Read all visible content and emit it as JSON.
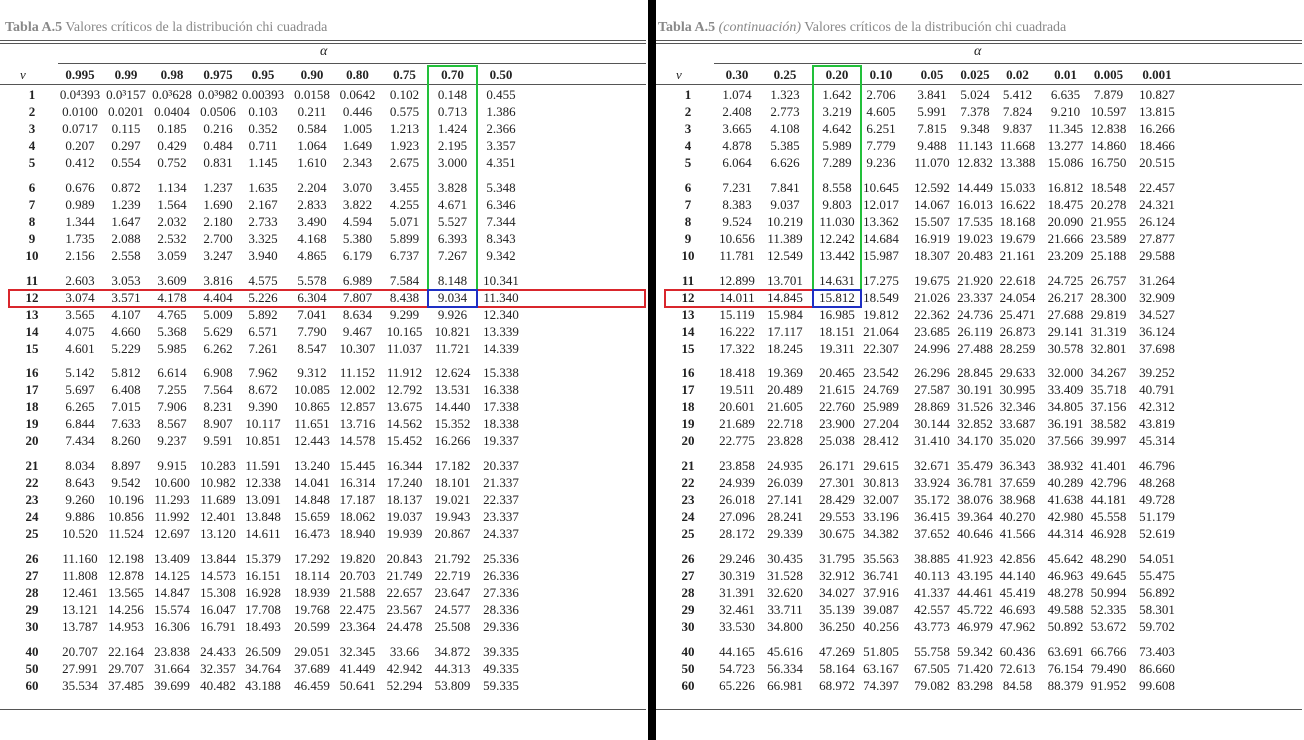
{
  "left": {
    "title_bold": "Tabla A.5",
    "title_rest": "Valores críticos de la distribución chi cuadrada",
    "alpha_symbol": "α",
    "v_symbol": "v",
    "headers": [
      "0.995",
      "0.99",
      "0.98",
      "0.975",
      "0.95",
      "0.90",
      "0.80",
      "0.75",
      "0.70",
      "0.50"
    ],
    "rows": [
      {
        "v": "1",
        "values": [
          "0.0⁴393",
          "0.0³157",
          "0.0³628",
          "0.0³982",
          "0.00393",
          "0.0158",
          "0.0642",
          "0.102",
          "0.148",
          "0.455"
        ]
      },
      {
        "v": "2",
        "values": [
          "0.0100",
          "0.0201",
          "0.0404",
          "0.0506",
          "0.103",
          "0.211",
          "0.446",
          "0.575",
          "0.713",
          "1.386"
        ]
      },
      {
        "v": "3",
        "values": [
          "0.0717",
          "0.115",
          "0.185",
          "0.216",
          "0.352",
          "0.584",
          "1.005",
          "1.213",
          "1.424",
          "2.366"
        ]
      },
      {
        "v": "4",
        "values": [
          "0.207",
          "0.297",
          "0.429",
          "0.484",
          "0.711",
          "1.064",
          "1.649",
          "1.923",
          "2.195",
          "3.357"
        ]
      },
      {
        "v": "5",
        "values": [
          "0.412",
          "0.554",
          "0.752",
          "0.831",
          "1.145",
          "1.610",
          "2.343",
          "2.675",
          "3.000",
          "4.351"
        ]
      },
      {
        "v": "6",
        "values": [
          "0.676",
          "0.872",
          "1.134",
          "1.237",
          "1.635",
          "2.204",
          "3.070",
          "3.455",
          "3.828",
          "5.348"
        ]
      },
      {
        "v": "7",
        "values": [
          "0.989",
          "1.239",
          "1.564",
          "1.690",
          "2.167",
          "2.833",
          "3.822",
          "4.255",
          "4.671",
          "6.346"
        ]
      },
      {
        "v": "8",
        "values": [
          "1.344",
          "1.647",
          "2.032",
          "2.180",
          "2.733",
          "3.490",
          "4.594",
          "5.071",
          "5.527",
          "7.344"
        ]
      },
      {
        "v": "9",
        "values": [
          "1.735",
          "2.088",
          "2.532",
          "2.700",
          "3.325",
          "4.168",
          "5.380",
          "5.899",
          "6.393",
          "8.343"
        ]
      },
      {
        "v": "10",
        "values": [
          "2.156",
          "2.558",
          "3.059",
          "3.247",
          "3.940",
          "4.865",
          "6.179",
          "6.737",
          "7.267",
          "9.342"
        ]
      },
      {
        "v": "11",
        "values": [
          "2.603",
          "3.053",
          "3.609",
          "3.816",
          "4.575",
          "5.578",
          "6.989",
          "7.584",
          "8.148",
          "10.341"
        ]
      },
      {
        "v": "12",
        "values": [
          "3.074",
          "3.571",
          "4.178",
          "4.404",
          "5.226",
          "6.304",
          "7.807",
          "8.438",
          "9.034",
          "11.340"
        ]
      },
      {
        "v": "13",
        "values": [
          "3.565",
          "4.107",
          "4.765",
          "5.009",
          "5.892",
          "7.041",
          "8.634",
          "9.299",
          "9.926",
          "12.340"
        ]
      },
      {
        "v": "14",
        "values": [
          "4.075",
          "4.660",
          "5.368",
          "5.629",
          "6.571",
          "7.790",
          "9.467",
          "10.165",
          "10.821",
          "13.339"
        ]
      },
      {
        "v": "15",
        "values": [
          "4.601",
          "5.229",
          "5.985",
          "6.262",
          "7.261",
          "8.547",
          "10.307",
          "11.037",
          "11.721",
          "14.339"
        ]
      },
      {
        "v": "16",
        "values": [
          "5.142",
          "5.812",
          "6.614",
          "6.908",
          "7.962",
          "9.312",
          "11.152",
          "11.912",
          "12.624",
          "15.338"
        ]
      },
      {
        "v": "17",
        "values": [
          "5.697",
          "6.408",
          "7.255",
          "7.564",
          "8.672",
          "10.085",
          "12.002",
          "12.792",
          "13.531",
          "16.338"
        ]
      },
      {
        "v": "18",
        "values": [
          "6.265",
          "7.015",
          "7.906",
          "8.231",
          "9.390",
          "10.865",
          "12.857",
          "13.675",
          "14.440",
          "17.338"
        ]
      },
      {
        "v": "19",
        "values": [
          "6.844",
          "7.633",
          "8.567",
          "8.907",
          "10.117",
          "11.651",
          "13.716",
          "14.562",
          "15.352",
          "18.338"
        ]
      },
      {
        "v": "20",
        "values": [
          "7.434",
          "8.260",
          "9.237",
          "9.591",
          "10.851",
          "12.443",
          "14.578",
          "15.452",
          "16.266",
          "19.337"
        ]
      },
      {
        "v": "21",
        "values": [
          "8.034",
          "8.897",
          "9.915",
          "10.283",
          "11.591",
          "13.240",
          "15.445",
          "16.344",
          "17.182",
          "20.337"
        ]
      },
      {
        "v": "22",
        "values": [
          "8.643",
          "9.542",
          "10.600",
          "10.982",
          "12.338",
          "14.041",
          "16.314",
          "17.240",
          "18.101",
          "21.337"
        ]
      },
      {
        "v": "23",
        "values": [
          "9.260",
          "10.196",
          "11.293",
          "11.689",
          "13.091",
          "14.848",
          "17.187",
          "18.137",
          "19.021",
          "22.337"
        ]
      },
      {
        "v": "24",
        "values": [
          "9.886",
          "10.856",
          "11.992",
          "12.401",
          "13.848",
          "15.659",
          "18.062",
          "19.037",
          "19.943",
          "23.337"
        ]
      },
      {
        "v": "25",
        "values": [
          "10.520",
          "11.524",
          "12.697",
          "13.120",
          "14.611",
          "16.473",
          "18.940",
          "19.939",
          "20.867",
          "24.337"
        ]
      },
      {
        "v": "26",
        "values": [
          "11.160",
          "12.198",
          "13.409",
          "13.844",
          "15.379",
          "17.292",
          "19.820",
          "20.843",
          "21.792",
          "25.336"
        ]
      },
      {
        "v": "27",
        "values": [
          "11.808",
          "12.878",
          "14.125",
          "14.573",
          "16.151",
          "18.114",
          "20.703",
          "21.749",
          "22.719",
          "26.336"
        ]
      },
      {
        "v": "28",
        "values": [
          "12.461",
          "13.565",
          "14.847",
          "15.308",
          "16.928",
          "18.939",
          "21.588",
          "22.657",
          "23.647",
          "27.336"
        ]
      },
      {
        "v": "29",
        "values": [
          "13.121",
          "14.256",
          "15.574",
          "16.047",
          "17.708",
          "19.768",
          "22.475",
          "23.567",
          "24.577",
          "28.336"
        ]
      },
      {
        "v": "30",
        "values": [
          "13.787",
          "14.953",
          "16.306",
          "16.791",
          "18.493",
          "20.599",
          "23.364",
          "24.478",
          "25.508",
          "29.336"
        ]
      },
      {
        "v": "40",
        "values": [
          "20.707",
          "22.164",
          "23.838",
          "24.433",
          "26.509",
          "29.051",
          "32.345",
          "33.66",
          "34.872",
          "39.335"
        ]
      },
      {
        "v": "50",
        "values": [
          "27.991",
          "29.707",
          "31.664",
          "32.357",
          "34.764",
          "37.689",
          "41.449",
          "42.942",
          "44.313",
          "49.335"
        ]
      },
      {
        "v": "60",
        "values": [
          "35.534",
          "37.485",
          "39.699",
          "40.482",
          "43.188",
          "46.459",
          "50.641",
          "52.294",
          "53.809",
          "59.335"
        ]
      }
    ]
  },
  "right": {
    "title_bold": "Tabla A.5",
    "title_italic": "(continuación)",
    "title_rest": "Valores críticos de la distribución chi cuadrada",
    "alpha_symbol": "α",
    "v_symbol": "v",
    "headers": [
      "0.30",
      "0.25",
      "0.20",
      "0.10",
      "0.05",
      "0.025",
      "0.02",
      "0.01",
      "0.005",
      "0.001"
    ],
    "rows": [
      {
        "v": "1",
        "values": [
          "1.074",
          "1.323",
          "1.642",
          "2.706",
          "3.841",
          "5.024",
          "5.412",
          "6.635",
          "7.879",
          "10.827"
        ]
      },
      {
        "v": "2",
        "values": [
          "2.408",
          "2.773",
          "3.219",
          "4.605",
          "5.991",
          "7.378",
          "7.824",
          "9.210",
          "10.597",
          "13.815"
        ]
      },
      {
        "v": "3",
        "values": [
          "3.665",
          "4.108",
          "4.642",
          "6.251",
          "7.815",
          "9.348",
          "9.837",
          "11.345",
          "12.838",
          "16.266"
        ]
      },
      {
        "v": "4",
        "values": [
          "4.878",
          "5.385",
          "5.989",
          "7.779",
          "9.488",
          "11.143",
          "11.668",
          "13.277",
          "14.860",
          "18.466"
        ]
      },
      {
        "v": "5",
        "values": [
          "6.064",
          "6.626",
          "7.289",
          "9.236",
          "11.070",
          "12.832",
          "13.388",
          "15.086",
          "16.750",
          "20.515"
        ]
      },
      {
        "v": "6",
        "values": [
          "7.231",
          "7.841",
          "8.558",
          "10.645",
          "12.592",
          "14.449",
          "15.033",
          "16.812",
          "18.548",
          "22.457"
        ]
      },
      {
        "v": "7",
        "values": [
          "8.383",
          "9.037",
          "9.803",
          "12.017",
          "14.067",
          "16.013",
          "16.622",
          "18.475",
          "20.278",
          "24.321"
        ]
      },
      {
        "v": "8",
        "values": [
          "9.524",
          "10.219",
          "11.030",
          "13.362",
          "15.507",
          "17.535",
          "18.168",
          "20.090",
          "21.955",
          "26.124"
        ]
      },
      {
        "v": "9",
        "values": [
          "10.656",
          "11.389",
          "12.242",
          "14.684",
          "16.919",
          "19.023",
          "19.679",
          "21.666",
          "23.589",
          "27.877"
        ]
      },
      {
        "v": "10",
        "values": [
          "11.781",
          "12.549",
          "13.442",
          "15.987",
          "18.307",
          "20.483",
          "21.161",
          "23.209",
          "25.188",
          "29.588"
        ]
      },
      {
        "v": "11",
        "values": [
          "12.899",
          "13.701",
          "14.631",
          "17.275",
          "19.675",
          "21.920",
          "22.618",
          "24.725",
          "26.757",
          "31.264"
        ]
      },
      {
        "v": "12",
        "values": [
          "14.011",
          "14.845",
          "15.812",
          "18.549",
          "21.026",
          "23.337",
          "24.054",
          "26.217",
          "28.300",
          "32.909"
        ]
      },
      {
        "v": "13",
        "values": [
          "15.119",
          "15.984",
          "16.985",
          "19.812",
          "22.362",
          "24.736",
          "25.471",
          "27.688",
          "29.819",
          "34.527"
        ]
      },
      {
        "v": "14",
        "values": [
          "16.222",
          "17.117",
          "18.151",
          "21.064",
          "23.685",
          "26.119",
          "26.873",
          "29.141",
          "31.319",
          "36.124"
        ]
      },
      {
        "v": "15",
        "values": [
          "17.322",
          "18.245",
          "19.311",
          "22.307",
          "24.996",
          "27.488",
          "28.259",
          "30.578",
          "32.801",
          "37.698"
        ]
      },
      {
        "v": "16",
        "values": [
          "18.418",
          "19.369",
          "20.465",
          "23.542",
          "26.296",
          "28.845",
          "29.633",
          "32.000",
          "34.267",
          "39.252"
        ]
      },
      {
        "v": "17",
        "values": [
          "19.511",
          "20.489",
          "21.615",
          "24.769",
          "27.587",
          "30.191",
          "30.995",
          "33.409",
          "35.718",
          "40.791"
        ]
      },
      {
        "v": "18",
        "values": [
          "20.601",
          "21.605",
          "22.760",
          "25.989",
          "28.869",
          "31.526",
          "32.346",
          "34.805",
          "37.156",
          "42.312"
        ]
      },
      {
        "v": "19",
        "values": [
          "21.689",
          "22.718",
          "23.900",
          "27.204",
          "30.144",
          "32.852",
          "33.687",
          "36.191",
          "38.582",
          "43.819"
        ]
      },
      {
        "v": "20",
        "values": [
          "22.775",
          "23.828",
          "25.038",
          "28.412",
          "31.410",
          "34.170",
          "35.020",
          "37.566",
          "39.997",
          "45.314"
        ]
      },
      {
        "v": "21",
        "values": [
          "23.858",
          "24.935",
          "26.171",
          "29.615",
          "32.671",
          "35.479",
          "36.343",
          "38.932",
          "41.401",
          "46.796"
        ]
      },
      {
        "v": "22",
        "values": [
          "24.939",
          "26.039",
          "27.301",
          "30.813",
          "33.924",
          "36.781",
          "37.659",
          "40.289",
          "42.796",
          "48.268"
        ]
      },
      {
        "v": "23",
        "values": [
          "26.018",
          "27.141",
          "28.429",
          "32.007",
          "35.172",
          "38.076",
          "38.968",
          "41.638",
          "44.181",
          "49.728"
        ]
      },
      {
        "v": "24",
        "values": [
          "27.096",
          "28.241",
          "29.553",
          "33.196",
          "36.415",
          "39.364",
          "40.270",
          "42.980",
          "45.558",
          "51.179"
        ]
      },
      {
        "v": "25",
        "values": [
          "28.172",
          "29.339",
          "30.675",
          "34.382",
          "37.652",
          "40.646",
          "41.566",
          "44.314",
          "46.928",
          "52.619"
        ]
      },
      {
        "v": "26",
        "values": [
          "29.246",
          "30.435",
          "31.795",
          "35.563",
          "38.885",
          "41.923",
          "42.856",
          "45.642",
          "48.290",
          "54.051"
        ]
      },
      {
        "v": "27",
        "values": [
          "30.319",
          "31.528",
          "32.912",
          "36.741",
          "40.113",
          "43.195",
          "44.140",
          "46.963",
          "49.645",
          "55.475"
        ]
      },
      {
        "v": "28",
        "values": [
          "31.391",
          "32.620",
          "34.027",
          "37.916",
          "41.337",
          "44.461",
          "45.419",
          "48.278",
          "50.994",
          "56.892"
        ]
      },
      {
        "v": "29",
        "values": [
          "32.461",
          "33.711",
          "35.139",
          "39.087",
          "42.557",
          "45.722",
          "46.693",
          "49.588",
          "52.335",
          "58.301"
        ]
      },
      {
        "v": "30",
        "values": [
          "33.530",
          "34.800",
          "36.250",
          "40.256",
          "43.773",
          "46.979",
          "47.962",
          "50.892",
          "53.672",
          "59.702"
        ]
      },
      {
        "v": "40",
        "values": [
          "44.165",
          "45.616",
          "47.269",
          "51.805",
          "55.758",
          "59.342",
          "60.436",
          "63.691",
          "66.766",
          "73.403"
        ]
      },
      {
        "v": "50",
        "values": [
          "54.723",
          "56.334",
          "58.164",
          "63.167",
          "67.505",
          "71.420",
          "72.613",
          "76.154",
          "79.490",
          "86.660"
        ]
      },
      {
        "v": "60",
        "values": [
          "65.226",
          "66.981",
          "68.972",
          "74.397",
          "79.082",
          "83.298",
          "84.58",
          "88.379",
          "91.952",
          "99.608"
        ]
      }
    ]
  },
  "highlights": {
    "row_color": "#d9262c",
    "column_color": "#22c03a",
    "cell_color": "#1f2fc4",
    "left_column_alpha": "0.70",
    "right_column_alpha": "0.20",
    "row_v": "12"
  }
}
